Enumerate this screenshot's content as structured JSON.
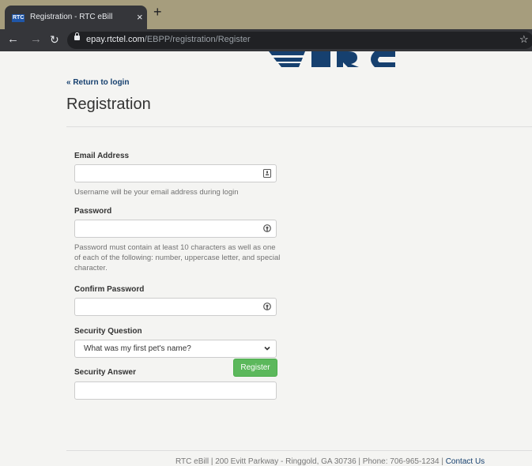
{
  "browser": {
    "tab": {
      "favicon_text": "RTC",
      "title": "Registration - RTC eBill",
      "close_glyph": "×"
    },
    "new_tab_glyph": "+",
    "url_host": "epay.rtctel.com",
    "url_path": "/EBPP/registration/Register",
    "icons": [
      "back-arrow-icon",
      "forward-arrow-icon",
      "reload-icon",
      "lock-icon",
      "bookmark-star-icon"
    ]
  },
  "page": {
    "back_link": "« Return to login",
    "title": "Registration",
    "fields": {
      "email": {
        "label": "Email Address",
        "value": "",
        "help": "Username will be your email address during login"
      },
      "password": {
        "label": "Password",
        "value": "",
        "help": "Password must contain at least 10 characters as well as one of each of the following: number, uppercase letter, and special character."
      },
      "confirm_password": {
        "label": "Confirm Password",
        "value": ""
      },
      "security_question": {
        "label": "Security Question",
        "selected": "What was my first pet's name?"
      },
      "security_answer": {
        "label": "Security Answer",
        "value": ""
      }
    },
    "register_label": "Register",
    "footer": {
      "text": "RTC eBill | 200 Evitt Parkway - Ringgold, GA 30736 | Phone: 706-965-1234 | ",
      "contact_label": "Contact Us"
    }
  },
  "colors": {
    "tab_bar": "#a69d7d",
    "chrome_dark": "#35363a",
    "page_bg": "#f4f4f2",
    "link": "#16406f",
    "logo": "#16406f",
    "register_button": "#5cb85c"
  }
}
